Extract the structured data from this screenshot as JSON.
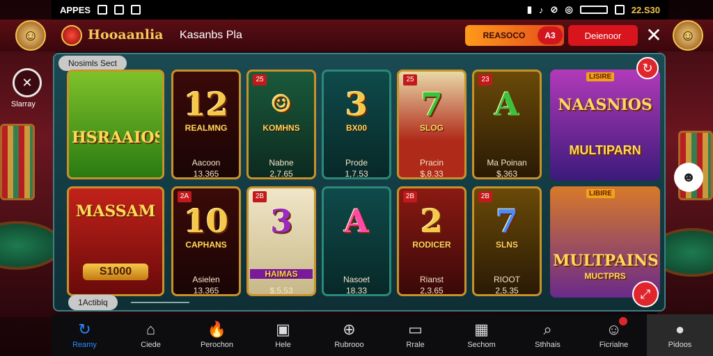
{
  "status_bar": {
    "carrier": "APPES",
    "clock": "22.S30"
  },
  "header": {
    "logo_text": "Hooaanlia",
    "subtitle": "Kasanbs Pla",
    "orange_button": "REASOCO",
    "orange_badge": "A3",
    "red_button": "Deienoor",
    "close_glyph": "✕"
  },
  "left_float": {
    "label": "Slarray"
  },
  "panel": {
    "section_label": "Nosimls Sect",
    "footer_label": "1Actiblq"
  },
  "tiles_row1": [
    {
      "kind": "feature",
      "title": "HSRAAIOS",
      "name": "",
      "price": ""
    },
    {
      "corner": "",
      "big": "12",
      "title": "REALMNG",
      "name": "Aacoon",
      "price": "13.365"
    },
    {
      "corner": "25",
      "big": "",
      "title": "KOMHNS",
      "name": "Nabne",
      "price": "2,7.65"
    },
    {
      "corner": "",
      "big": "3",
      "title": "BX00",
      "name": "Prode",
      "price": "1,7.53"
    },
    {
      "corner": "25",
      "big": "7",
      "title": "SLOG",
      "name": "Pracin",
      "price": "$,8.33"
    },
    {
      "corner": "23",
      "big": "A",
      "title": "",
      "name": "Ma Poinan",
      "price": "$,363"
    },
    {
      "kind": "feature",
      "tag": "LISIRE",
      "title": "NAASNIOS",
      "sub": "MULTIPARN",
      "name": "",
      "price": ""
    }
  ],
  "tiles_row2": [
    {
      "kind": "feature",
      "title": "MASSAM",
      "price_btn": "S1000"
    },
    {
      "corner": "2A",
      "big": "10",
      "title": "CAPHANS",
      "name": "Asielen",
      "price": "13.365"
    },
    {
      "corner": "2B",
      "big": "3",
      "title": "HAIMAS",
      "name": "",
      "price": "$,5,53"
    },
    {
      "corner": "",
      "big": "A",
      "title": "",
      "name": "Nasoet",
      "price": "18.33"
    },
    {
      "corner": "2B",
      "big": "2",
      "title": "RODICER",
      "name": "Rianst",
      "price": "2,3.65"
    },
    {
      "corner": "2B",
      "big": "7",
      "title": "SLNS",
      "name": "RIOOT",
      "price": "2,5.35"
    },
    {
      "kind": "feature",
      "tag": "LIBIRE",
      "title": "MULTPAINS",
      "sub": "MUCTPRS",
      "name": "",
      "price": ""
    }
  ],
  "nav": [
    {
      "icon": "↻",
      "label": "Reamy",
      "active": true
    },
    {
      "icon": "⌂",
      "label": "Ciede"
    },
    {
      "icon": "🔥",
      "label": "Perochon",
      "fire": true
    },
    {
      "icon": "▣",
      "label": "Hele"
    },
    {
      "icon": "⊕",
      "label": "Rubrooo"
    },
    {
      "icon": "▭",
      "label": "Rrale"
    },
    {
      "icon": "▦",
      "label": "Sechom"
    },
    {
      "icon": "⌕",
      "label": "Sthhais"
    },
    {
      "icon": "☺",
      "label": "Ficrialne",
      "dot": true
    },
    {
      "icon": "●",
      "label": "Pidoos",
      "dim": true
    }
  ]
}
